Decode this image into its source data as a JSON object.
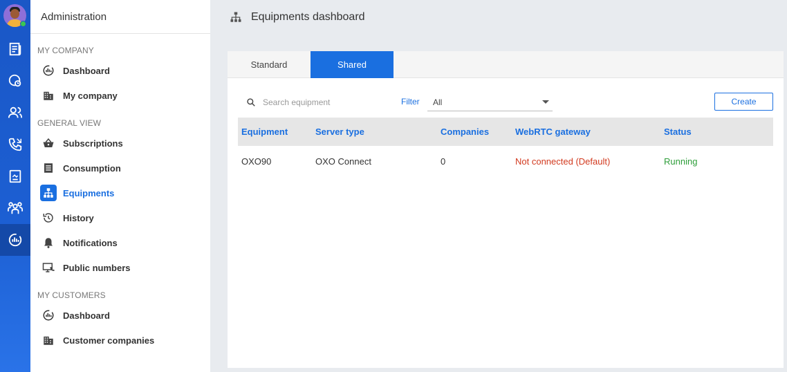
{
  "sidebar": {
    "title": "Administration",
    "sections": [
      {
        "title": "MY COMPANY",
        "items": [
          {
            "label": "Dashboard",
            "icon": "dashboard-gauge-icon"
          },
          {
            "label": "My company",
            "icon": "building-icon"
          }
        ]
      },
      {
        "title": "GENERAL VIEW",
        "items": [
          {
            "label": "Subscriptions",
            "icon": "basket-icon"
          },
          {
            "label": "Consumption",
            "icon": "list-icon"
          },
          {
            "label": "Equipments",
            "icon": "network-icon"
          },
          {
            "label": "History",
            "icon": "history-icon"
          },
          {
            "label": "Notifications",
            "icon": "bell-icon"
          },
          {
            "label": "Public numbers",
            "icon": "monitor-phone-icon"
          }
        ]
      },
      {
        "title": "MY CUSTOMERS",
        "items": [
          {
            "label": "Dashboard",
            "icon": "dashboard-gauge-icon"
          },
          {
            "label": "Customer companies",
            "icon": "building-icon"
          }
        ]
      }
    ],
    "active_item": "Equipments"
  },
  "rail": {
    "icons": [
      "news-icon",
      "clock-dial-icon",
      "users-icon",
      "phone-icon",
      "document-icon",
      "group-icon",
      "dashboard-gauge-icon"
    ],
    "active_icon": "dashboard-gauge-icon"
  },
  "main": {
    "title": "Equipments dashboard",
    "tabs": [
      {
        "label": "Standard"
      },
      {
        "label": "Shared"
      }
    ],
    "active_tab": "Shared",
    "search": {
      "placeholder": "Search equipment",
      "value": ""
    },
    "filter": {
      "label": "Filter",
      "value": "All"
    },
    "create_label": "Create",
    "table": {
      "columns": [
        "Equipment",
        "Server type",
        "Companies",
        "WebRTC gateway",
        "Status"
      ],
      "rows": [
        {
          "equipment": "OXO90",
          "server_type": "OXO Connect",
          "companies": "0",
          "webrtc_gateway": "Not connected (Default)",
          "status": "Running"
        }
      ]
    }
  },
  "colors": {
    "accent": "#1a6fe0",
    "rail": "#1a57c6",
    "error": "#d23a1f",
    "success": "#2e9e3a"
  }
}
